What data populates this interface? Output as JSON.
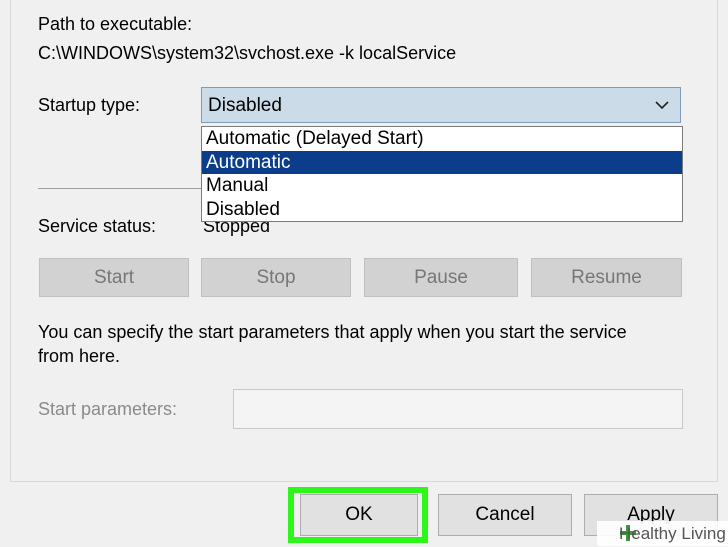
{
  "path": {
    "label": "Path to executable:",
    "value": "C:\\WINDOWS\\system32\\svchost.exe -k localService"
  },
  "startup": {
    "label": "Startup type:",
    "selected_value": "Disabled",
    "options": [
      "Automatic (Delayed Start)",
      "Automatic",
      "Manual",
      "Disabled"
    ],
    "highlighted_option": "Automatic"
  },
  "status": {
    "label": "Service status:",
    "value": "Stopped"
  },
  "service_buttons": {
    "start": "Start",
    "stop": "Stop",
    "pause": "Pause",
    "resume": "Resume"
  },
  "help_text": {
    "line1": "You can specify the start parameters that apply when you start the service",
    "line2": "from here."
  },
  "params": {
    "label": "Start parameters:",
    "value": ""
  },
  "dialog_buttons": {
    "ok": "OK",
    "cancel": "Cancel",
    "apply": "Apply"
  },
  "colors": {
    "highlight_border": "#2ef51a",
    "selected_option_bg": "#0c3d8a",
    "combo_bg": "#ccdbe8"
  },
  "watermark": {
    "text": "Healthy Living"
  }
}
